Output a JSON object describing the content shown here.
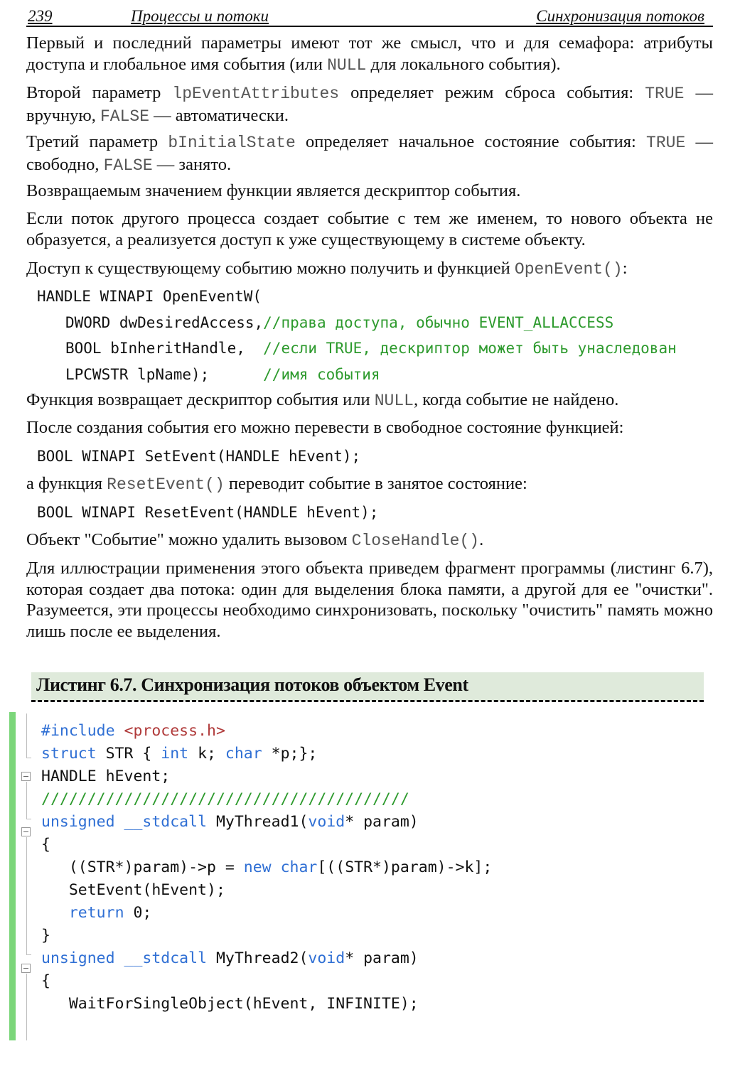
{
  "header": {
    "page_number": "239",
    "chapter": "Процессы и потоки",
    "section": "Синхронизация потоков"
  },
  "paragraphs": [
    {
      "parts": [
        "Первый и последний параметры имеют тот же смысл, что и для семафора: атрибуты доступа и глобальное имя события (или ",
        "NULL",
        " для локального события)."
      ]
    },
    {
      "parts": [
        "Второй параметр ",
        "lpEventAttributes",
        " определяет режим сброса события: ",
        "TRUE",
        " — вручную, ",
        "FALSE",
        " — автоматически."
      ]
    },
    {
      "parts": [
        "Третий параметр ",
        "bInitialState",
        " определяет начальное состояние события: ",
        "TRUE",
        " — свободно, ",
        "FALSE",
        " — занято."
      ]
    },
    {
      "parts": [
        "Возвращаемым значением функции является дескриптор события."
      ]
    },
    {
      "parts": [
        "Если поток другого процесса создает событие с тем же именем, то нового объекта не образуется, а реализуется доступ к уже существующему в системе объекту."
      ]
    },
    {
      "parts": [
        "Доступ к существующему событию можно получить и функцией ",
        "OpenEvent()",
        ":"
      ]
    },
    {
      "parts": [
        "Функция возвращает дескриптор события или ",
        "NULL",
        ", когда событие не найдено."
      ]
    },
    {
      "parts": [
        "После создания события его можно перевести в свободное состояние функцией:"
      ]
    },
    {
      "parts": [
        "а функция ",
        "ResetEvent()",
        " переводит событие в занятое состояние:"
      ]
    },
    {
      "parts": [
        "Объект \"Событие\" можно удалить вызовом ",
        "CloseHandle()",
        "."
      ]
    },
    {
      "parts": [
        "Для иллюстрации применения этого объекта приведем фрагмент программы (листинг 6.7), которая создает два потока: один для выделения блока памяти, а другой для ее \"очистки\". Разумеется, эти процессы необходимо синхронизовать, поскольку \"очистить\" память можно лишь после ее выделения."
      ]
    }
  ],
  "open_event_decl": {
    "line1": "HANDLE WINAPI OpenEventW(",
    "line2_code": "DWORD dwDesiredAccess,",
    "line2_comment": "//права доступа, обычно EVENT_ALLACCESS",
    "line3_code": "BOOL bInheritHandle,  ",
    "line3_comment": "//если TRUE, дескриптор может быть унаследован",
    "line4_code": "LPCWSTR lpName);      ",
    "line4_comment": "//имя события"
  },
  "set_event_decl": "BOOL WINAPI SetEvent(HANDLE hEvent);",
  "reset_event_decl": "BOOL WINAPI ResetEvent(HANDLE hEvent);",
  "listing": {
    "title": "Листинг 6.7. Синхронизация потоков объектом Event",
    "lines": [
      [
        {
          "t": "#include",
          "k": "kw"
        },
        {
          "t": " "
        },
        {
          "t": "<process.h>",
          "k": "str"
        }
      ],
      [
        {
          "t": "struct",
          "k": "kw"
        },
        {
          "t": " STR { "
        },
        {
          "t": "int",
          "k": "kw"
        },
        {
          "t": " k; "
        },
        {
          "t": "char",
          "k": "kw"
        },
        {
          "t": " *p;};"
        }
      ],
      [
        {
          "t": "HANDLE hEvent;"
        }
      ],
      [
        {
          "t": "////////////////////////////////////////",
          "k": "sl"
        }
      ],
      [
        {
          "t": "unsigned",
          "k": "kw"
        },
        {
          "t": " "
        },
        {
          "t": "__stdcall",
          "k": "kw"
        },
        {
          "t": " MyThread1("
        },
        {
          "t": "void",
          "k": "kw"
        },
        {
          "t": "* param)"
        }
      ],
      [
        {
          "t": "{"
        }
      ],
      [
        {
          "t": "   ((STR*)param)->p = "
        },
        {
          "t": "new",
          "k": "kw"
        },
        {
          "t": " "
        },
        {
          "t": "char",
          "k": "kw"
        },
        {
          "t": "[((STR*)param)->k];"
        }
      ],
      [
        {
          "t": "   SetEvent(hEvent);"
        }
      ],
      [
        {
          "t": "   "
        },
        {
          "t": "return",
          "k": "kw"
        },
        {
          "t": " 0;"
        }
      ],
      [
        {
          "t": "}"
        }
      ],
      [
        {
          "t": "unsigned",
          "k": "kw"
        },
        {
          "t": " "
        },
        {
          "t": "__stdcall",
          "k": "kw"
        },
        {
          "t": " MyThread2("
        },
        {
          "t": "void",
          "k": "kw"
        },
        {
          "t": "* param)"
        }
      ],
      [
        {
          "t": "{"
        }
      ],
      [
        {
          "t": "   WaitForSingleObject(hEvent, INFINITE);"
        }
      ]
    ]
  },
  "colors": {
    "keyword": "#2f6fd4",
    "string": "#b03a3a",
    "comment": "#2d9a2d",
    "listing_title_bg": "#dfeadb",
    "change_bar": "#7bd67a"
  }
}
